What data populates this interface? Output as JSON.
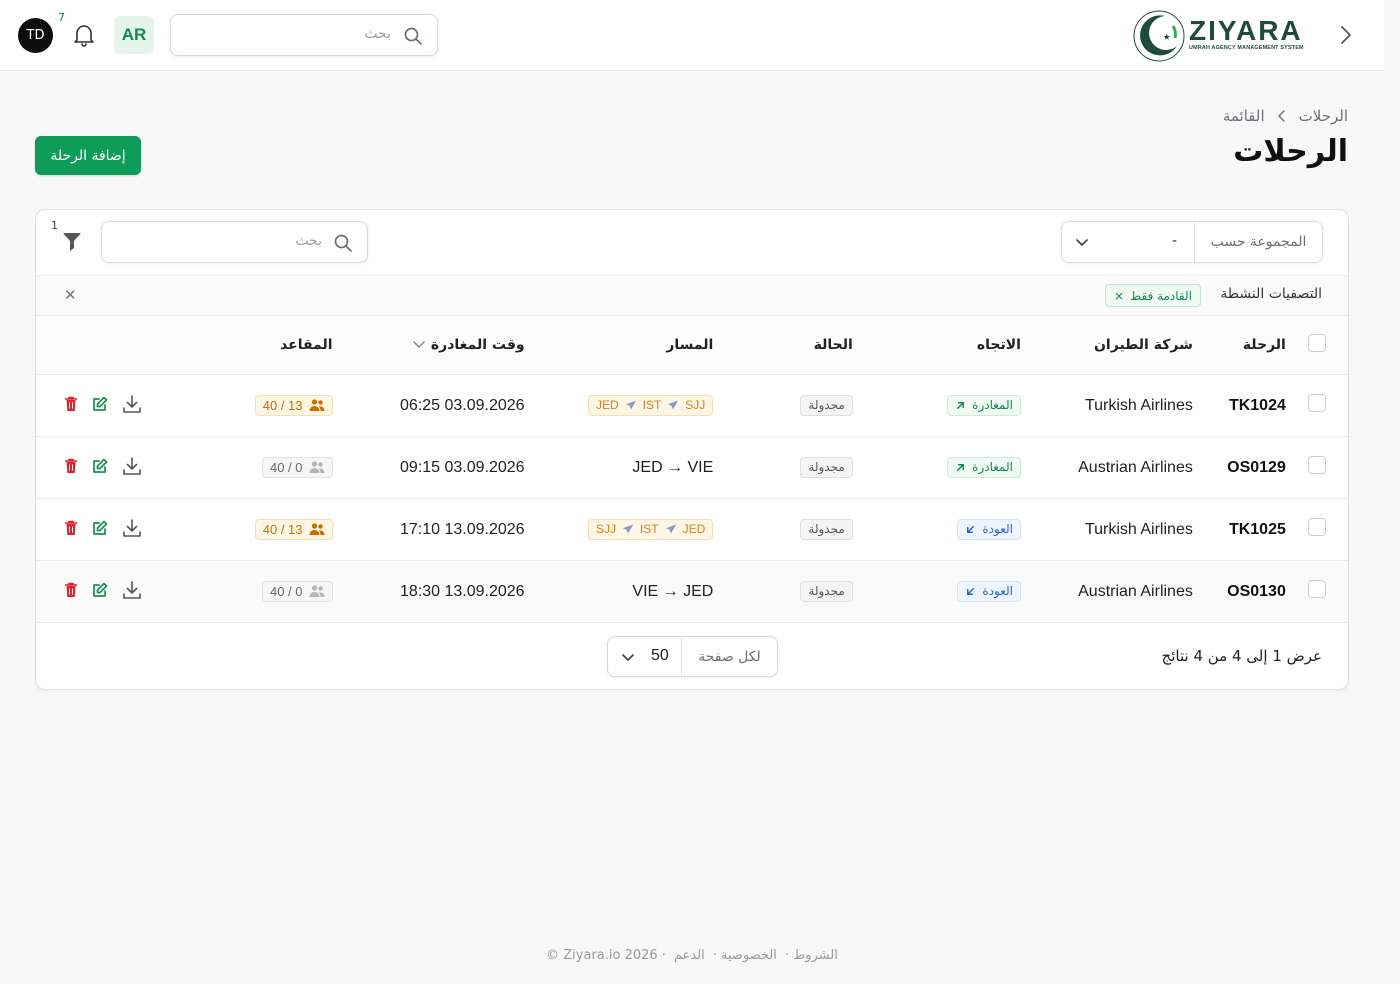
{
  "topbar": {
    "avatar_initials": "TD",
    "notification_count": "7",
    "language": "AR",
    "search_placeholder": "بحث",
    "logo_name": "ZIYARA",
    "logo_tagline": "UMRAH AGENCY MANAGEMENT SYSTEM"
  },
  "breadcrumb": [
    "الرحلات",
    "القائمة"
  ],
  "page_title": "الرحلات",
  "add_button": "إضافة الرحلة",
  "toolbar": {
    "group_by_label": "المجموعة حسب",
    "group_by_value": "-",
    "search_placeholder": "بحث",
    "filter_count": "1"
  },
  "active_filters": {
    "label": "التصفيات النشطة",
    "chips": [
      "القادمة فقط"
    ]
  },
  "table": {
    "headers": {
      "flight": "الرحلة",
      "airline": "شركة الطيران",
      "direction": "الاتجاه",
      "status": "الحالة",
      "route": "المسار",
      "departure_time": "وقت المغادرة",
      "seats": "المقاعد"
    },
    "rows": [
      {
        "flight": "TK1024",
        "airline": "Turkish Airlines",
        "direction": "المغادرة",
        "direction_type": "departure",
        "status": "مجدولة",
        "route_stops": [
          "JED",
          "IST",
          "SJJ"
        ],
        "route_text": "",
        "departure_time": "06:25 03.09.2026",
        "seats": "40 / 13",
        "seats_state": "booked"
      },
      {
        "flight": "OS0129",
        "airline": "Austrian Airlines",
        "direction": "المغادرة",
        "direction_type": "departure",
        "status": "مجدولة",
        "route_stops": [],
        "route_text": "JED → VIE",
        "departure_time": "09:15 03.09.2026",
        "seats": "40 / 0",
        "seats_state": "empty"
      },
      {
        "flight": "TK1025",
        "airline": "Turkish Airlines",
        "direction": "العودة",
        "direction_type": "return",
        "status": "مجدولة",
        "route_stops": [
          "SJJ",
          "IST",
          "JED"
        ],
        "route_text": "",
        "departure_time": "17:10 13.09.2026",
        "seats": "40 / 13",
        "seats_state": "booked"
      },
      {
        "flight": "OS0130",
        "airline": "Austrian Airlines",
        "direction": "العودة",
        "direction_type": "return",
        "status": "مجدولة",
        "route_stops": [],
        "route_text": "VIE → JED",
        "departure_time": "18:30 13.09.2026",
        "seats": "40 / 0",
        "seats_state": "empty"
      }
    ]
  },
  "pagination": {
    "results_text": "عرض 1 إلى 4 من 4 نتائج",
    "per_page_label": "لكل صفحة",
    "per_page_value": "50"
  },
  "footer": {
    "copyright": "© Ziyara.io 2026",
    "links": [
      "الشروط",
      "الخصوصية",
      "الدعم"
    ]
  },
  "colors": {
    "primary_green": "#0f9b58",
    "departure": "#0e8a52",
    "return": "#2a64c9",
    "route_badge": "#d8831a",
    "delete": "#e0242f"
  },
  "icons": [
    "search-icon",
    "bell-icon",
    "filter-icon",
    "chevron-down-icon",
    "chevron-right-icon",
    "arrow-up-right-icon",
    "arrow-down-left-icon",
    "plane-icon",
    "users-icon",
    "trash-icon",
    "edit-icon",
    "download-icon",
    "close-icon"
  ]
}
